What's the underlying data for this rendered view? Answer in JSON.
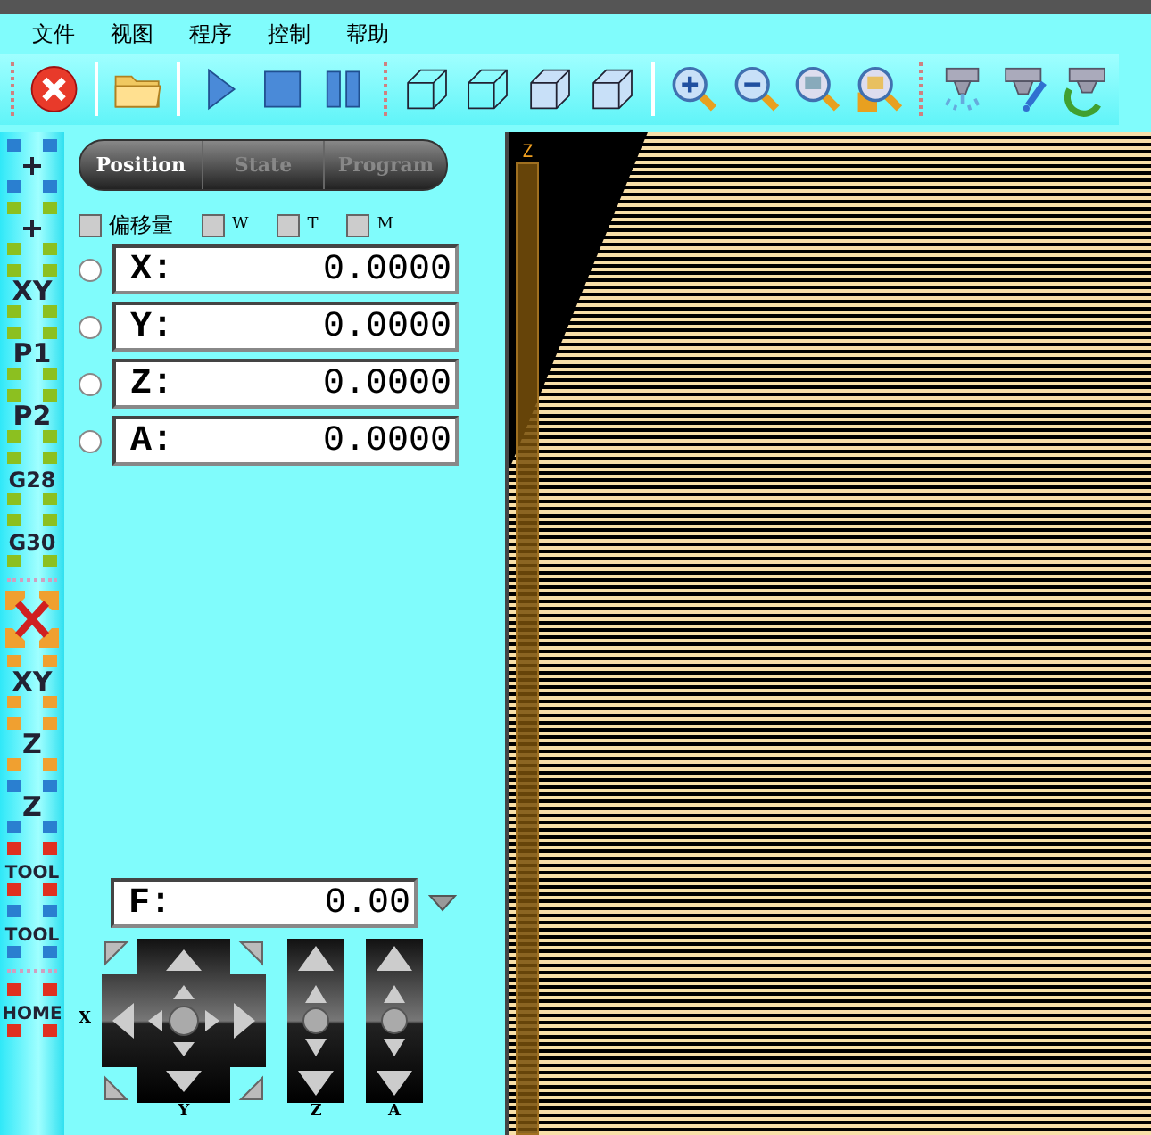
{
  "menu": [
    "文件",
    "视图",
    "程序",
    "控制",
    "帮助"
  ],
  "side_buttons": [
    {
      "kind": "plus",
      "color": "#2a7fd0"
    },
    {
      "kind": "plus",
      "color": "#8cc020"
    },
    {
      "kind": "text",
      "label": "XY",
      "color": "#8cc020"
    },
    {
      "kind": "text",
      "label": "P1",
      "color": "#8cc020"
    },
    {
      "kind": "text",
      "label": "P2",
      "color": "#8cc020"
    },
    {
      "kind": "text",
      "label": "G28",
      "color": "#8cc020"
    },
    {
      "kind": "text",
      "label": "G30",
      "color": "#8cc020"
    },
    {
      "kind": "separator"
    },
    {
      "kind": "cross",
      "color": "#f0a030"
    },
    {
      "kind": "text",
      "label": "XY",
      "color": "#f0a030"
    },
    {
      "kind": "text",
      "label": "Z",
      "color": "#f0a030"
    },
    {
      "kind": "text",
      "label": "Z",
      "color": "#2a7fd0"
    },
    {
      "kind": "text",
      "label": "TOOL",
      "color": "#e03020"
    },
    {
      "kind": "text",
      "label": "TOOL",
      "color": "#2a7fd0"
    },
    {
      "kind": "separator"
    },
    {
      "kind": "text",
      "label": "HOME",
      "color": "#e03020"
    }
  ],
  "tabs": [
    {
      "label": "Position",
      "selected": true
    },
    {
      "label": "State",
      "selected": false
    },
    {
      "label": "Program",
      "selected": false
    }
  ],
  "options": [
    {
      "label": "偏移量",
      "checked": false
    },
    {
      "label": "W",
      "checked": false
    },
    {
      "label": "T",
      "checked": false
    },
    {
      "label": "M",
      "checked": false
    }
  ],
  "axes": [
    {
      "label": "X:",
      "value": "0.0000",
      "selected": false
    },
    {
      "label": "Y:",
      "value": "0.0000",
      "selected": false
    },
    {
      "label": "Z:",
      "value": "0.0000",
      "selected": false
    },
    {
      "label": "A:",
      "value": "0.0000",
      "selected": false
    }
  ],
  "feed": {
    "label": "F:",
    "value": "0.00"
  },
  "jog": {
    "x_label": "X",
    "y_label": "Y",
    "z_label": "Z",
    "a_label": "A"
  },
  "view": {
    "z_label": "Z"
  }
}
